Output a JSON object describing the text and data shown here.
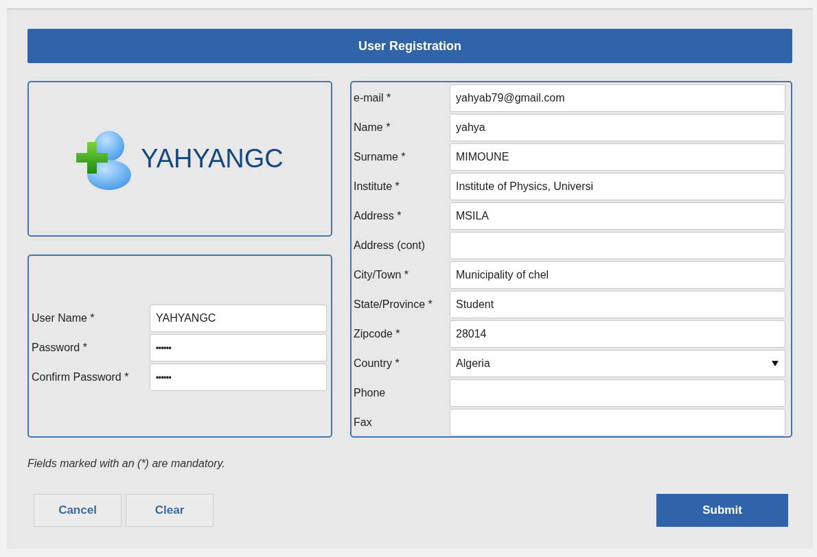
{
  "header": {
    "title": "User Registration"
  },
  "logo": {
    "text": "YAHYANGC"
  },
  "account_fields": [
    {
      "label": "User Name *",
      "kind": "text",
      "value": "YAHYANGC"
    },
    {
      "label": "Password *",
      "kind": "password",
      "value": "••••••"
    },
    {
      "label": "Confirm Password *",
      "kind": "password",
      "value": "••••••"
    }
  ],
  "profile_fields": [
    {
      "label": "e-mail *",
      "kind": "text",
      "value": "yahyab79@gmail.com"
    },
    {
      "label": "Name *",
      "kind": "text",
      "value": "yahya"
    },
    {
      "label": "Surname *",
      "kind": "text",
      "value": "MIMOUNE"
    },
    {
      "label": "Institute *",
      "kind": "text",
      "value": "Institute of Physics, Universi"
    },
    {
      "label": "Address *",
      "kind": "text",
      "value": "MSILA"
    },
    {
      "label": "Address (cont)",
      "kind": "text"
    },
    {
      "label": "City/Town *",
      "kind": "text",
      "value": "Municipality of chel"
    },
    {
      "label": "State/Province *",
      "kind": "text",
      "value": "Student"
    },
    {
      "label": "Zipcode *",
      "kind": "text",
      "value": "28014"
    },
    {
      "label": "Country *",
      "kind": "select",
      "value": "Algeria"
    },
    {
      "label": "Phone",
      "kind": "text"
    },
    {
      "label": "Fax",
      "kind": "text"
    }
  ],
  "note": "Fields marked with an (*) are mandatory.",
  "buttons": [
    {
      "label": "Cancel",
      "kind": "secondary"
    },
    {
      "label": "Clear",
      "kind": "secondary"
    },
    {
      "label": "Submit",
      "kind": "primary"
    }
  ]
}
